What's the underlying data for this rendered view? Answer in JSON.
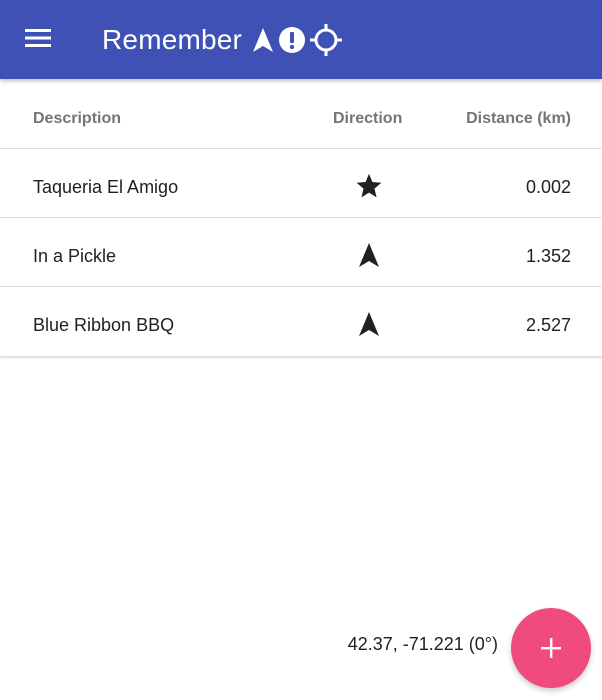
{
  "appbar": {
    "title": "Remember",
    "background": "#3f51b5",
    "menu_icon": "menu-icon",
    "status_icons": [
      "navigation-icon",
      "alert-circle-icon",
      "gps-target-icon"
    ]
  },
  "table": {
    "headers": {
      "description": "Description",
      "direction": "Direction",
      "distance": "Distance (km)"
    },
    "rows": [
      {
        "description": "Taqueria El Amigo",
        "direction_icon": "star-icon",
        "distance": "0.002"
      },
      {
        "description": "In a Pickle",
        "direction_icon": "navigation-arrow-icon",
        "distance": "1.352"
      },
      {
        "description": "Blue Ribbon BBQ",
        "direction_icon": "navigation-arrow-icon",
        "distance": "2.527"
      }
    ]
  },
  "footer": {
    "coordinates": "42.37, -71.221 (0°)",
    "fab_icon": "plus-icon",
    "fab_color": "#ef4b7f"
  }
}
